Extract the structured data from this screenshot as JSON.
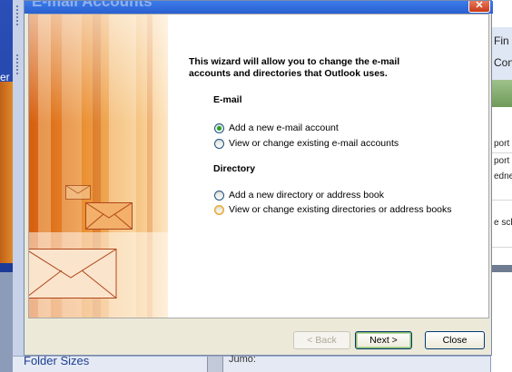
{
  "window": {
    "title": "E-mail Accounts",
    "close_glyph": "✕"
  },
  "intro_text": "This wizard will allow you to change the e-mail accounts and directories that Outlook uses.",
  "email_section": {
    "heading": "E-mail",
    "options": [
      {
        "label": "Add a new e-mail account",
        "selected": true
      },
      {
        "label": "View or change existing e-mail accounts",
        "selected": false
      }
    ]
  },
  "directory_section": {
    "heading": "Directory",
    "options": [
      {
        "label": "Add a new directory or address book",
        "selected": false
      },
      {
        "label": "View or change existing directories or address books",
        "selected": false
      }
    ]
  },
  "buttons": {
    "back": "< Back",
    "next": "Next >",
    "close": "Close"
  },
  "background": {
    "left_text": "er",
    "right_menu": [
      "Fin",
      "Cont"
    ],
    "right_items": [
      "port",
      "port",
      "edne",
      "e sch"
    ],
    "folder_sizes": "Folder Sizes",
    "bottom_text": "Jumo:"
  },
  "colors": {
    "titlebar": "#2a5fd0",
    "radio_selected": "#21a121",
    "art_orange": "#e08a2a"
  },
  "icons": [
    "envelope-icon",
    "close-icon",
    "radio-button"
  ]
}
